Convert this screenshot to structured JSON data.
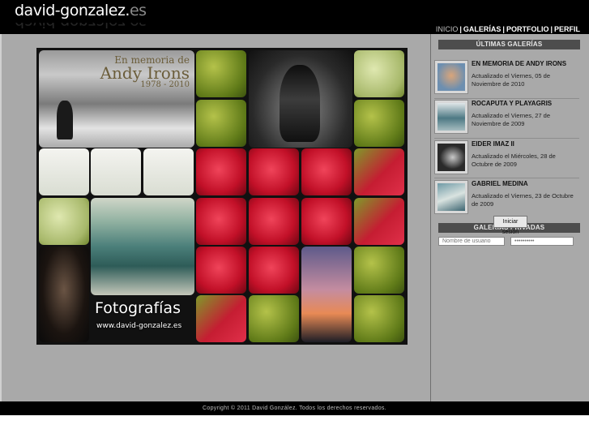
{
  "site": {
    "logo_main": "david-gonzalez.",
    "logo_tld": "es"
  },
  "nav": {
    "items": [
      "INICIO",
      "GALERÍAS",
      "PORTFOLIO",
      "PERFIL"
    ],
    "separator": "|",
    "active": "INICIO"
  },
  "hero": {
    "memoria_line1": "En memoria de",
    "memoria_line2": "Andy Irons",
    "memoria_line3": "1978 - 2010",
    "fotografias": "Fotografías",
    "url": "www.david-gonzalez.es"
  },
  "sidebar": {
    "latest_title": "ÚLTIMAS GALERÍAS",
    "galleries": [
      {
        "title": "EN MEMORIA DE ANDY IRONS",
        "meta": "Actualizado el Viernes, 05 de Noviembre de 2010"
      },
      {
        "title": "ROCAPUTA Y PLAYAGRIS",
        "meta": "Actualizado el Viernes, 27 de Noviembre de 2009"
      },
      {
        "title": "EIDER IMAZ II",
        "meta": "Actualizado el Miércoles, 28 de Octubre de 2009"
      },
      {
        "title": "GABRIEL MEDINA",
        "meta": "Actualizado el Viernes, 23 de Octubre de 2009"
      }
    ],
    "private_title": "GALERÍAS PRIVADAS",
    "username_placeholder": "Nombre de usuario",
    "password_placeholder": "••••••••••",
    "login_button": "Iniciar sesión"
  },
  "footer": {
    "copyright": "Copyright © 2011 David González. Todos los derechos reservados."
  },
  "colors": {
    "header_bg": "#000000",
    "main_bg": "#a9a9a9",
    "section_bar": "#4d4d4d",
    "rose_red": "#c21028",
    "leaf_green": "#7f9a2a"
  }
}
